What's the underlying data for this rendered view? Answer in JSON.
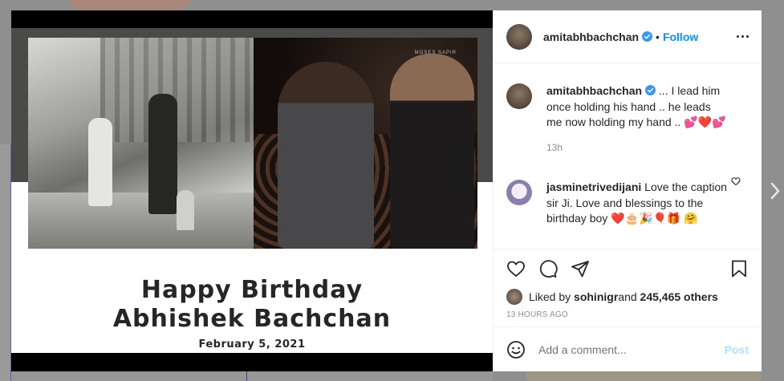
{
  "post": {
    "image_caption": {
      "line1": "Happy Birthday",
      "line2": "Abhishek Bachchan",
      "date": "February 5, 2021",
      "watermark": "MOSES SAPIR"
    }
  },
  "header": {
    "username": "amitabhbachchan",
    "separator": "•",
    "follow_label": "Follow",
    "verified_icon": "verified-badge-icon",
    "more_icon": "more-options-icon"
  },
  "caption": {
    "username": "amitabhbachchan",
    "text": " ... I lead him once holding his hand .. he leads me now holding my hand .. 💕❤️💕",
    "time": "13h"
  },
  "comments": [
    {
      "username": "jasminetrivedijani",
      "text": " Love the caption sir Ji. Love and blessings to the birthday boy ❤️🎂🎉🎈🎁 🤗",
      "like_icon": "heart-outline-icon"
    }
  ],
  "actions": {
    "like_icon": "heart-icon",
    "comment_icon": "comment-icon",
    "share_icon": "paper-plane-icon",
    "save_icon": "bookmark-icon"
  },
  "likes": {
    "prefix": "Liked by ",
    "user": "sohinigr",
    "middle": " and ",
    "count": "245,465 others"
  },
  "timestamp": "13 HOURS AGO",
  "add_comment": {
    "placeholder": "Add a comment...",
    "post_label": "Post",
    "emoji_icon": "smiley-icon"
  },
  "colors": {
    "accent": "#0095f6",
    "post_disabled": "#b2dffc",
    "muted": "#8e8e8e",
    "text": "#262626"
  }
}
